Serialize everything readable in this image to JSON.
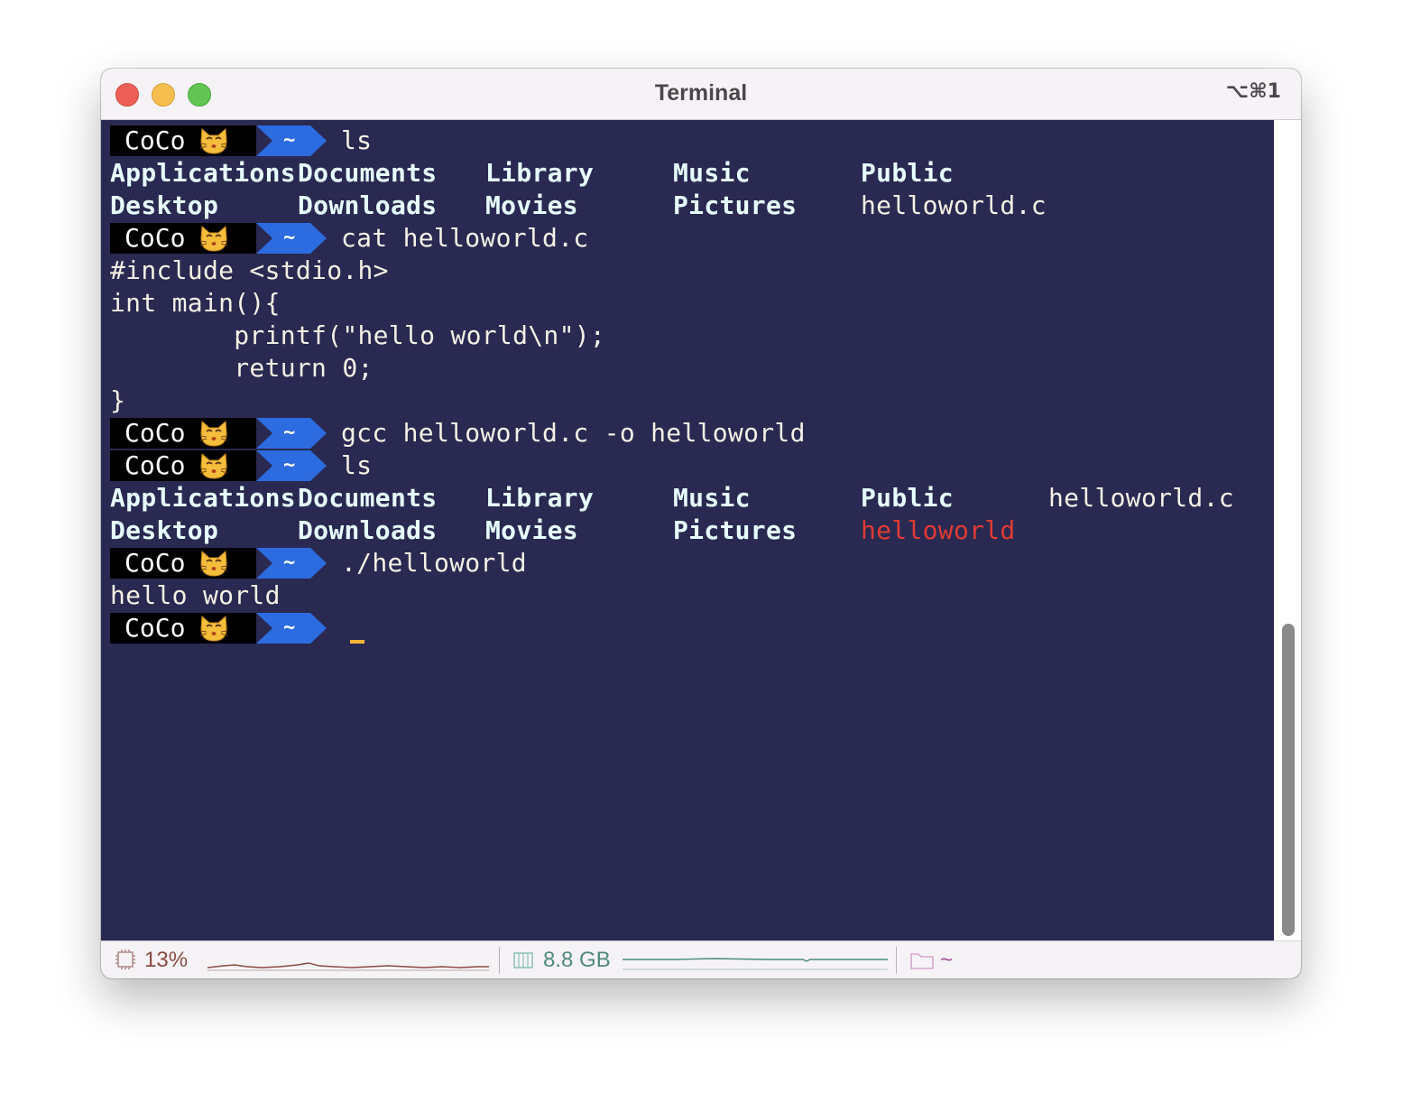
{
  "window": {
    "title": "Terminal",
    "shortcut": "⌥⌘1"
  },
  "prompt": {
    "user": "CoCo",
    "emoji": "kissing-cat-emoji",
    "dir": "~"
  },
  "terminal": {
    "cmd1": "ls",
    "ls1": {
      "row1": [
        "Applications",
        "Documents",
        "Library",
        "Music",
        "Public"
      ],
      "row2": [
        "Desktop",
        "Downloads",
        "Movies",
        "Pictures",
        "helloworld.c"
      ]
    },
    "cmd2": "cat helloworld.c",
    "code": [
      "#include <stdio.h>",
      "int main(){",
      "        printf(\"hello world\\n\");",
      "        return 0;",
      "}"
    ],
    "cmd3": "gcc helloworld.c -o helloworld",
    "cmd4": "ls",
    "ls2": {
      "row1": [
        "Applications",
        "Documents",
        "Library",
        "Music",
        "Public",
        "helloworld.c"
      ],
      "row2": [
        "Desktop",
        "Downloads",
        "Movies",
        "Pictures",
        "helloworld"
      ]
    },
    "cmd5": "./helloworld",
    "output": "hello world"
  },
  "statusbar": {
    "cpu": "13%",
    "memory": "8.8 GB",
    "directory": "~"
  },
  "colors": {
    "background": "#2a2951",
    "prompt_dir_bg": "#2c6be0",
    "directory_text": "#e8ffff",
    "executable_text": "#e03a34",
    "cursor": "#f5b53b"
  }
}
